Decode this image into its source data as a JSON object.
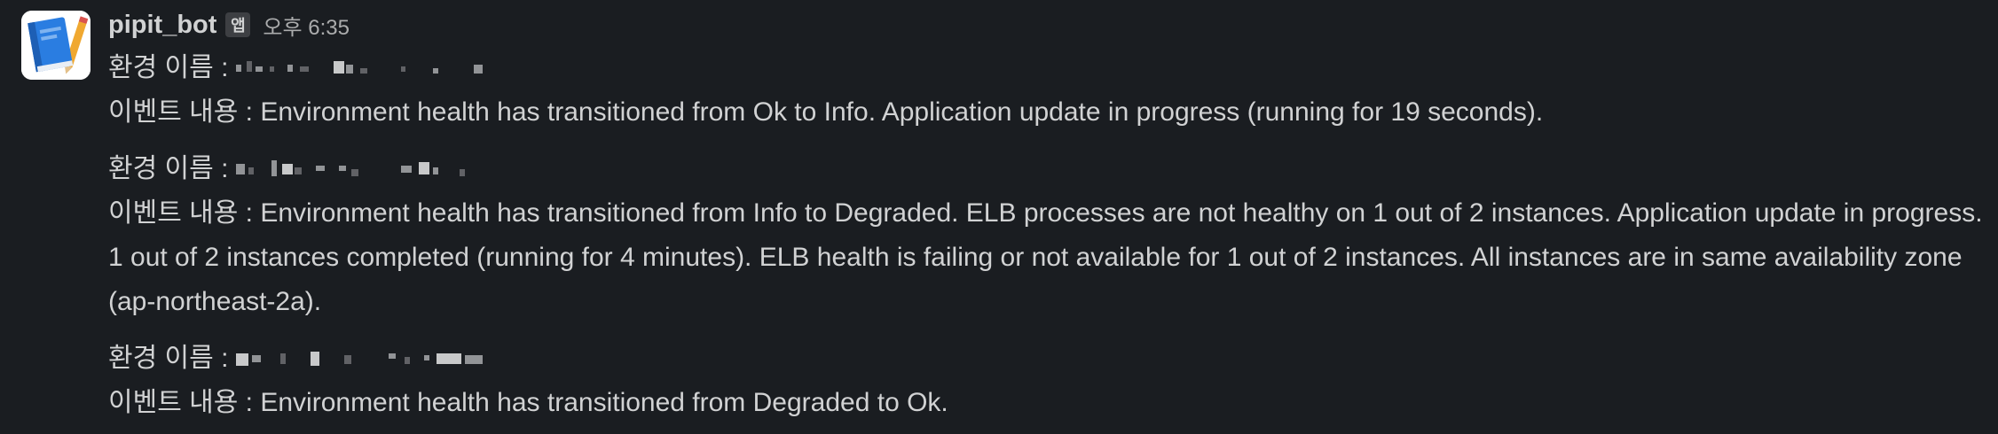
{
  "message": {
    "username": "pipit_bot",
    "app_badge": "앱",
    "timestamp": "오후 6:35",
    "avatar_icon": "blue-book-icon",
    "blocks": [
      {
        "env_label": "환경 이름 : ",
        "event_label": "이벤트 내용 : ",
        "event_text": "Environment health has transitioned from Ok to Info. Application update in progress (running for 19 seconds)."
      },
      {
        "env_label": "환경 이름 : ",
        "event_label": "이벤트 내용 : ",
        "event_text": "Environment health has transitioned from Info to Degraded. ELB processes are not healthy on 1 out of 2 instances. Application update in progress. 1 out of 2 instances completed (running for 4 minutes). ELB health is failing or not available for 1 out of 2 instances. All instances are in same availability zone (ap-northeast-2a)."
      },
      {
        "env_label": "환경 이름 : ",
        "event_label": "이벤트 내용 : ",
        "event_text": "Environment health has transitioned from Degraded to Ok."
      }
    ]
  },
  "colors": {
    "background": "#1a1d21",
    "text": "#d1d2d3",
    "muted": "#abacad",
    "badge_bg": "#3d3f43",
    "avatar_book": "#2a7de1"
  }
}
